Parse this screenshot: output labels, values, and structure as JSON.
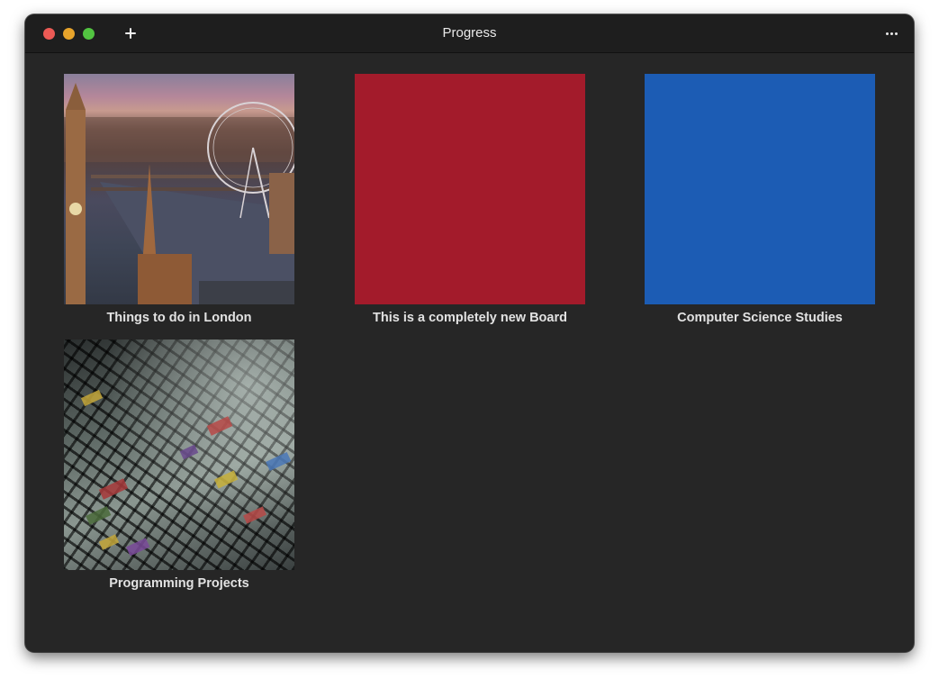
{
  "window": {
    "title": "Progress"
  },
  "colors": {
    "window_bg": "#262626",
    "titlebar_bg": "#1e1e1e",
    "close": "#ec5a55",
    "minimize": "#e8a42b",
    "maximize": "#52c441"
  },
  "toolbar": {
    "add_icon": "plus-icon",
    "more_icon": "ellipsis-icon"
  },
  "boards": [
    {
      "label": "Things to do in London",
      "thumbnail": "photo-london",
      "color": ""
    },
    {
      "label": "This is a completely new Board",
      "thumbnail": "solid-color",
      "color": "#a31b2b"
    },
    {
      "label": "Computer Science Studies",
      "thumbnail": "solid-color",
      "color": "#1c5cb4"
    },
    {
      "label": "Programming Projects",
      "thumbnail": "photo-keyboard",
      "color": ""
    }
  ]
}
